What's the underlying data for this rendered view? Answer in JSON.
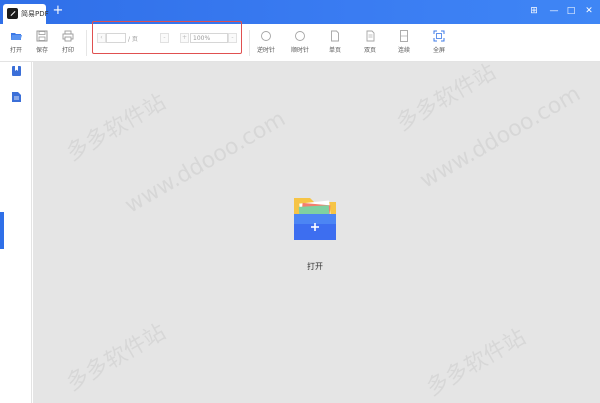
{
  "window": {
    "tab_title": "简易PDF",
    "new_tab": "+",
    "controls": {
      "skin": "⊞",
      "minimize": "—",
      "maximize": "□",
      "close": "✕"
    }
  },
  "toolbar": {
    "open": "打开",
    "save": "保存",
    "print": "打印",
    "page_input": "",
    "page_total": "/ 页",
    "page_prev": "‹",
    "zoom_minus": "-",
    "zoom_value": "100%",
    "zoom_dropdown": "-",
    "zoom_plus": "+",
    "rotate_ccw": "逆时针",
    "rotate_cw": "顺时针",
    "single_page": "单页",
    "double_page": "双页",
    "continuous": "连续",
    "fullscreen": "全屏"
  },
  "main": {
    "open_label": "打开"
  },
  "watermark": {
    "line1": "多多软件站",
    "line2": "www.ddooo.com"
  },
  "colors": {
    "titlebar": "#2f6fe8",
    "highlight": "#e05050",
    "folder_back": "#f6c445",
    "folder_front": "#3d6ef0"
  }
}
